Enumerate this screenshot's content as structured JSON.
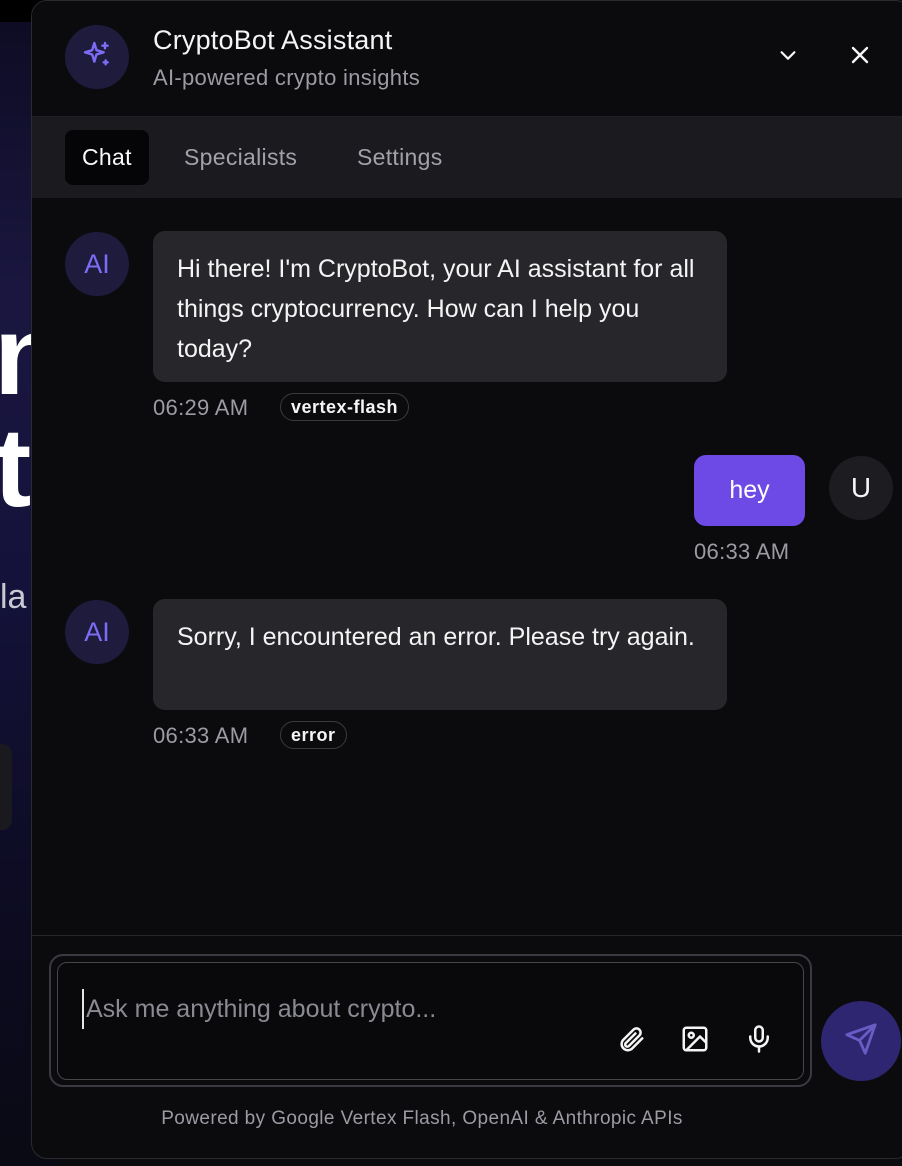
{
  "background": {
    "heading_line1": "n",
    "heading_line2": "t",
    "subtext": "la"
  },
  "header": {
    "title": "CryptoBot Assistant",
    "subtitle": "AI-powered crypto insights",
    "bot_icon": "sparkles-icon",
    "collapse_icon": "chevron-down-icon",
    "close_icon": "close-icon"
  },
  "tabs": [
    {
      "label": "Chat",
      "active": true
    },
    {
      "label": "Specialists",
      "active": false
    },
    {
      "label": "Settings",
      "active": false
    }
  ],
  "messages": [
    {
      "role": "ai",
      "avatar": "AI",
      "text": "Hi there! I'm CryptoBot, your AI assistant for all things cryptocurrency. How can I help you today?",
      "time": "06:29 AM",
      "badge": "vertex-flash"
    },
    {
      "role": "user",
      "avatar": "U",
      "text": "hey",
      "time": "06:33 AM"
    },
    {
      "role": "ai",
      "avatar": "AI",
      "text": "Sorry, I encountered an error. Please try again.",
      "time": "06:33 AM",
      "badge": "error"
    }
  ],
  "composer": {
    "placeholder": "Ask me anything about crypto...",
    "value": "",
    "attach_icon": "paperclip-icon",
    "image_icon": "image-icon",
    "mic_icon": "microphone-icon",
    "send_icon": "send-icon"
  },
  "footer": "Powered by Google Vertex Flash, OpenAI & Anthropic APIs",
  "colors": {
    "accent": "#6d4ae6",
    "ai_text": "#7c6cf6",
    "bubble_ai": "#27272b",
    "panel_bg": "#0b0b0e"
  }
}
